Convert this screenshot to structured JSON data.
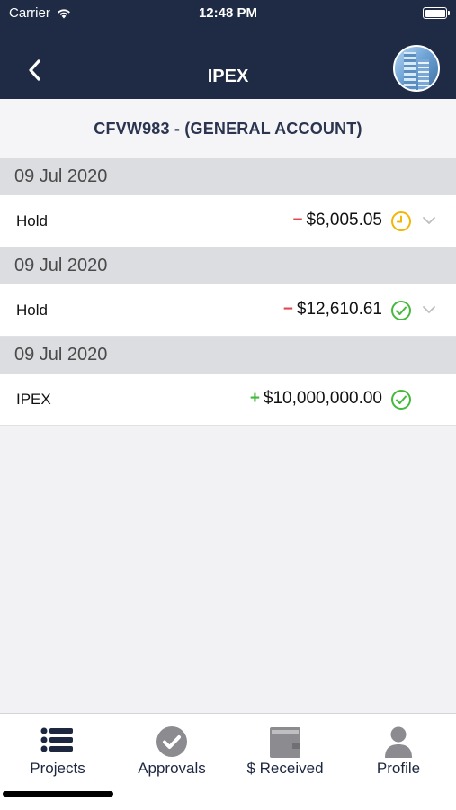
{
  "status_bar": {
    "carrier": "Carrier",
    "time": "12:48 PM"
  },
  "nav": {
    "title": "IPEX"
  },
  "account": {
    "title": "CFVW983 - (GENERAL ACCOUNT)"
  },
  "transactions": [
    {
      "date": "09 Jul 2020",
      "label": "Hold",
      "sign": "−",
      "amount": "$6,005.05",
      "status": "pending-clock-icon",
      "status_color": "#f2b705",
      "expandable": true
    },
    {
      "date": "09 Jul 2020",
      "label": "Hold",
      "sign": "−",
      "amount": "$12,610.61",
      "status": "check-circle-icon",
      "status_color": "#45b93c",
      "expandable": true
    },
    {
      "date": "09 Jul 2020",
      "label": "IPEX",
      "sign": "+",
      "amount": "$10,000,000.00",
      "status": "check-circle-icon",
      "status_color": "#45b93c",
      "expandable": false
    }
  ],
  "tabbar": {
    "projects": "Projects",
    "approvals": "Approvals",
    "received": "$ Received",
    "profile": "Profile"
  },
  "colors": {
    "nav_bg": "#1f2a44",
    "negative": "#e0474f",
    "positive": "#45b93c",
    "pending": "#f2b705"
  }
}
